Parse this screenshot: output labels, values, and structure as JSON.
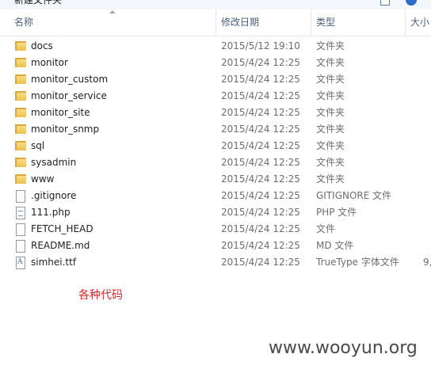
{
  "top_strip": {
    "cut_text": "新建文件夹"
  },
  "columns": {
    "name": "名称",
    "date": "修改日期",
    "type": "类型",
    "size": "大小"
  },
  "files": [
    {
      "name": "docs",
      "date": "2015/5/12 19:10",
      "type": "文件夹",
      "size": "",
      "icon": "folder-icon"
    },
    {
      "name": "monitor",
      "date": "2015/4/24 12:25",
      "type": "文件夹",
      "size": "",
      "icon": "folder-icon"
    },
    {
      "name": "monitor_custom",
      "date": "2015/4/24 12:25",
      "type": "文件夹",
      "size": "",
      "icon": "folder-icon"
    },
    {
      "name": "monitor_service",
      "date": "2015/4/24 12:25",
      "type": "文件夹",
      "size": "",
      "icon": "folder-icon"
    },
    {
      "name": "monitor_site",
      "date": "2015/4/24 12:25",
      "type": "文件夹",
      "size": "",
      "icon": "folder-icon"
    },
    {
      "name": "monitor_snmp",
      "date": "2015/4/24 12:25",
      "type": "文件夹",
      "size": "",
      "icon": "folder-icon"
    },
    {
      "name": "sql",
      "date": "2015/4/24 12:25",
      "type": "文件夹",
      "size": "",
      "icon": "folder-icon"
    },
    {
      "name": "sysadmin",
      "date": "2015/4/24 12:25",
      "type": "文件夹",
      "size": "",
      "icon": "folder-icon"
    },
    {
      "name": "www",
      "date": "2015/4/24 12:25",
      "type": "文件夹",
      "size": "",
      "icon": "folder-icon"
    },
    {
      "name": ".gitignore",
      "date": "2015/4/24 12:25",
      "type": "GITIGNORE 文件",
      "size": "",
      "icon": "file-icon"
    },
    {
      "name": "111.php",
      "date": "2015/4/24 12:25",
      "type": "PHP 文件",
      "size": "",
      "icon": "php-file-icon"
    },
    {
      "name": "FETCH_HEAD",
      "date": "2015/4/24 12:25",
      "type": "文件",
      "size": "",
      "icon": "file-icon"
    },
    {
      "name": "README.md",
      "date": "2015/4/24 12:25",
      "type": "MD 文件",
      "size": "",
      "icon": "file-icon"
    },
    {
      "name": "simhei.ttf",
      "date": "2015/4/24 12:25",
      "type": "TrueType 字体文件",
      "size": "9,",
      "icon": "font-file-icon"
    }
  ],
  "caption": "各种代码",
  "watermark": "www.wooyun.org"
}
